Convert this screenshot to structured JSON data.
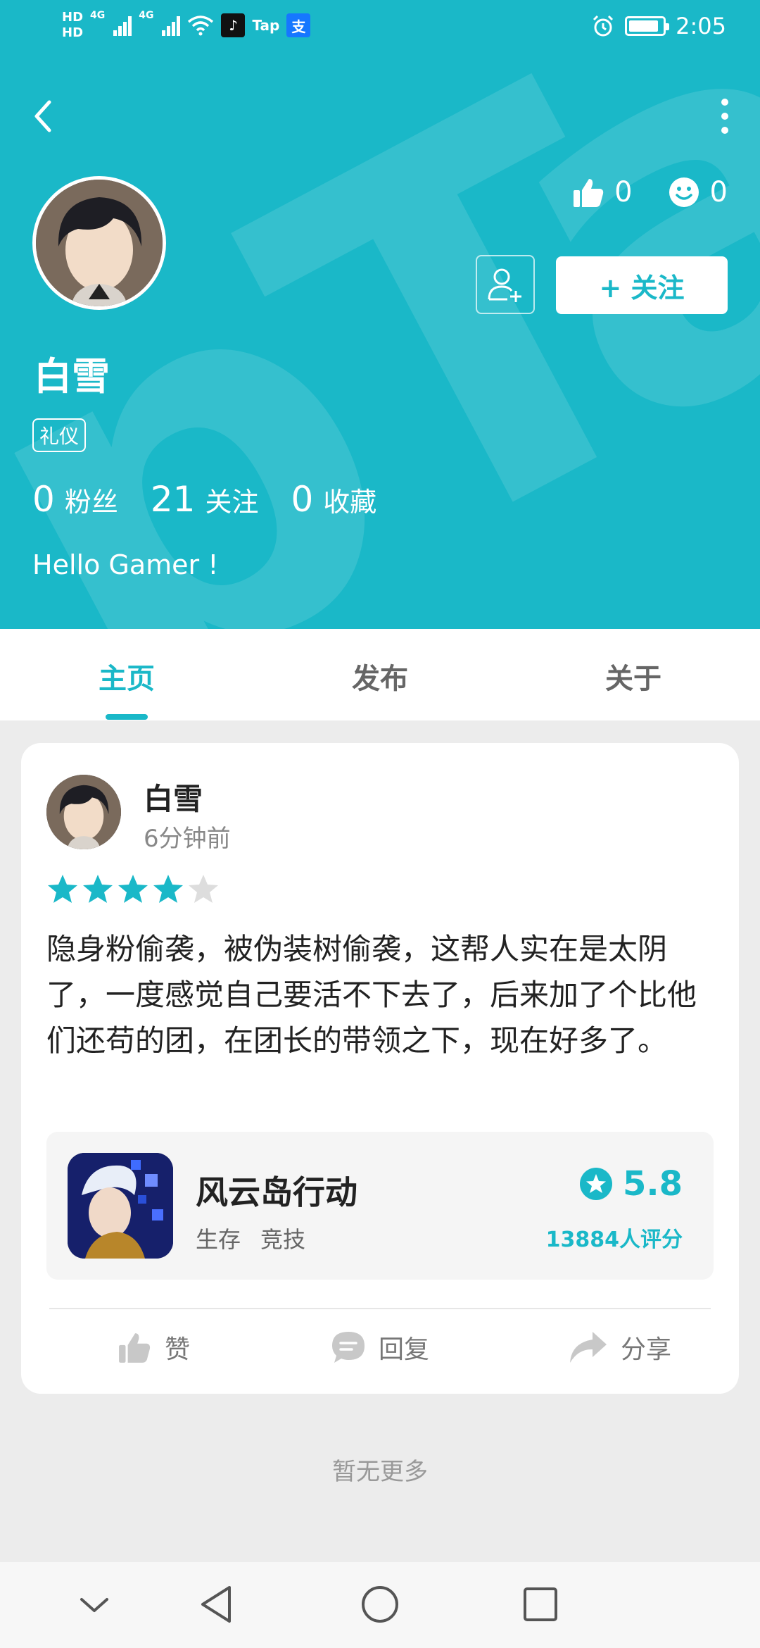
{
  "status_bar": {
    "hd1": "HD",
    "hd2": "HD",
    "net1": "4G",
    "net2": "4G",
    "app1": "♪",
    "app2": "Tap",
    "app3": "支",
    "time": "2:05",
    "battery_level": 0.9
  },
  "profile": {
    "like_count": "0",
    "smile_count": "0",
    "follow_label": "+ 关注",
    "username": "白雪",
    "tag": "礼仪",
    "fans_count": "0",
    "fans_label": "粉丝",
    "following_count": "21",
    "following_label": "关注",
    "collect_count": "0",
    "collect_label": "收藏",
    "bio": "Hello Gamer !"
  },
  "tabs": [
    {
      "label": "主页"
    },
    {
      "label": "发布"
    },
    {
      "label": "关于"
    }
  ],
  "post": {
    "author": "白雪",
    "time": "6分钟前",
    "rating": 4,
    "rating_max": 5,
    "text": "隐身粉偷袭，被伪装树偷袭，这帮人实在是太阴了，一度感觉自己要活不下去了，后来加了个比他们还苟的团，在团长的带领之下，现在好多了。",
    "game": {
      "name": "风云岛行动",
      "tags": [
        "生存",
        "竞技"
      ],
      "score": "5.8",
      "ratings": "13884人评分"
    },
    "actions": {
      "like": "赞",
      "reply": "回复",
      "share": "分享"
    }
  },
  "footer": {
    "no_more": "暂无更多"
  },
  "colors": {
    "accent": "#1ab8c8",
    "star_off": "#dddddd"
  }
}
